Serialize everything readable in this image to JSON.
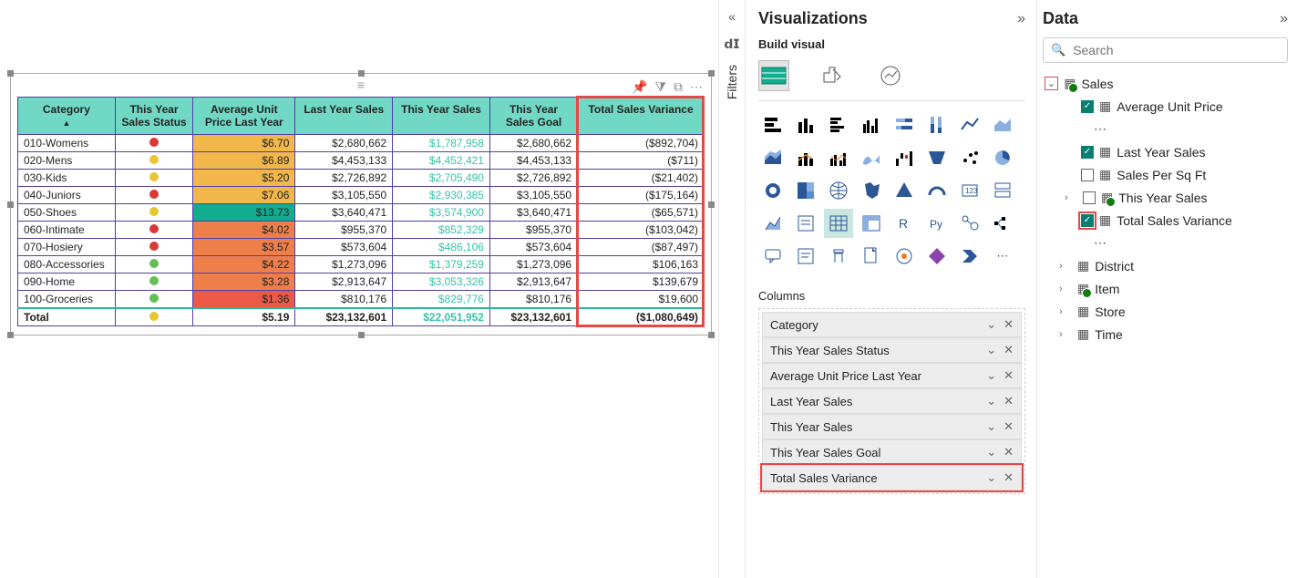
{
  "panes": {
    "filters_label": "Filters",
    "viz": {
      "title": "Visualizations",
      "subtitle": "Build visual",
      "section_columns": "Columns",
      "column_fields": [
        "Category",
        "This Year Sales Status",
        "Average Unit Price Last Year",
        "Last Year Sales",
        "This Year Sales",
        "This Year Sales Goal",
        "Total Sales Variance"
      ]
    },
    "data": {
      "title": "Data",
      "search_placeholder": "Search",
      "tables": {
        "sales": {
          "name": "Sales",
          "fields": [
            {
              "label": "Average Unit Price",
              "checked": true
            },
            {
              "label": "Last Year Sales",
              "checked": true
            },
            {
              "label": "Sales Per Sq Ft",
              "checked": false
            },
            {
              "label": "This Year Sales",
              "checked": false,
              "expandable": true
            },
            {
              "label": "Total Sales Variance",
              "checked": true,
              "highlight": true
            }
          ]
        },
        "others": [
          {
            "name": "District"
          },
          {
            "name": "Item"
          },
          {
            "name": "Store"
          },
          {
            "name": "Time"
          }
        ]
      }
    }
  },
  "table": {
    "headers": [
      "Category",
      "This Year Sales Status",
      "Average Unit Price Last Year",
      "Last Year Sales",
      "This Year Sales",
      "This Year Sales Goal",
      "Total Sales Variance"
    ],
    "rows": [
      {
        "category": "010-Womens",
        "status": "red",
        "aupBg": "#f1b74a",
        "aup": "$6.70",
        "ly": "$2,680,662",
        "ty": "$1,787,958",
        "goal": "$2,680,662",
        "var": "($892,704)"
      },
      {
        "category": "020-Mens",
        "status": "yellow",
        "aupBg": "#f1b74a",
        "aup": "$6.89",
        "ly": "$4,453,133",
        "ty": "$4,452,421",
        "goal": "$4,453,133",
        "var": "($711)"
      },
      {
        "category": "030-Kids",
        "status": "yellow",
        "aupBg": "#f1b74a",
        "aup": "$5.20",
        "ly": "$2,726,892",
        "ty": "$2,705,490",
        "goal": "$2,726,892",
        "var": "($21,402)"
      },
      {
        "category": "040-Juniors",
        "status": "red",
        "aupBg": "#f1b74a",
        "aup": "$7.06",
        "ly": "$3,105,550",
        "ty": "$2,930,385",
        "goal": "$3,105,550",
        "var": "($175,164)"
      },
      {
        "category": "050-Shoes",
        "status": "yellow",
        "aupBg": "#12ac8f",
        "aup": "$13.73",
        "ly": "$3,640,471",
        "ty": "$3,574,900",
        "goal": "$3,640,471",
        "var": "($65,571)"
      },
      {
        "category": "060-Intimate",
        "status": "red",
        "aupBg": "#ee7f4b",
        "aup": "$4.02",
        "ly": "$955,370",
        "ty": "$852,329",
        "goal": "$955,370",
        "var": "($103,042)"
      },
      {
        "category": "070-Hosiery",
        "status": "red",
        "aupBg": "#ee7f4b",
        "aup": "$3.57",
        "ly": "$573,604",
        "ty": "$486,106",
        "goal": "$573,604",
        "var": "($87,497)"
      },
      {
        "category": "080-Accessories",
        "status": "green",
        "aupBg": "#ee7f4b",
        "aup": "$4.22",
        "ly": "$1,273,096",
        "ty": "$1,379,259",
        "goal": "$1,273,096",
        "var": "$106,163"
      },
      {
        "category": "090-Home",
        "status": "green",
        "aupBg": "#ee7f4b",
        "aup": "$3.28",
        "ly": "$2,913,647",
        "ty": "$3,053,326",
        "goal": "$2,913,647",
        "var": "$139,679"
      },
      {
        "category": "100-Groceries",
        "status": "green",
        "aupBg": "#ec5a47",
        "aup": "$1.36",
        "ly": "$810,176",
        "ty": "$829,776",
        "goal": "$810,176",
        "var": "$19,600"
      }
    ],
    "total": {
      "label": "Total",
      "status": "yellow",
      "aup": "$5.19",
      "ly": "$23,132,601",
      "ty": "$22,051,952",
      "goal": "$23,132,601",
      "var": "($1,080,649)"
    }
  },
  "chart_data": {
    "type": "table",
    "title": "Sales table visual",
    "columns": [
      "Category",
      "This Year Sales Status",
      "Average Unit Price Last Year",
      "Last Year Sales",
      "This Year Sales",
      "This Year Sales Goal",
      "Total Sales Variance"
    ],
    "rows": [
      [
        "010-Womens",
        "red",
        6.7,
        2680662,
        1787958,
        2680662,
        -892704
      ],
      [
        "020-Mens",
        "yellow",
        6.89,
        4453133,
        4452421,
        4453133,
        -711
      ],
      [
        "030-Kids",
        "yellow",
        5.2,
        2726892,
        2705490,
        2726892,
        -21402
      ],
      [
        "040-Juniors",
        "red",
        7.06,
        3105550,
        2930385,
        3105550,
        -175164
      ],
      [
        "050-Shoes",
        "yellow",
        13.73,
        3640471,
        3574900,
        3640471,
        -65571
      ],
      [
        "060-Intimate",
        "red",
        4.02,
        955370,
        852329,
        955370,
        -103042
      ],
      [
        "070-Hosiery",
        "red",
        3.57,
        573604,
        486106,
        573604,
        -87497
      ],
      [
        "080-Accessories",
        "green",
        4.22,
        1273096,
        1379259,
        1273096,
        106163
      ],
      [
        "090-Home",
        "green",
        3.28,
        2913647,
        3053326,
        2913647,
        139679
      ],
      [
        "100-Groceries",
        "green",
        1.36,
        810176,
        829776,
        810176,
        19600
      ]
    ],
    "totals": [
      "Total",
      "yellow",
      5.19,
      23132601,
      22051952,
      23132601,
      -1080649
    ]
  }
}
